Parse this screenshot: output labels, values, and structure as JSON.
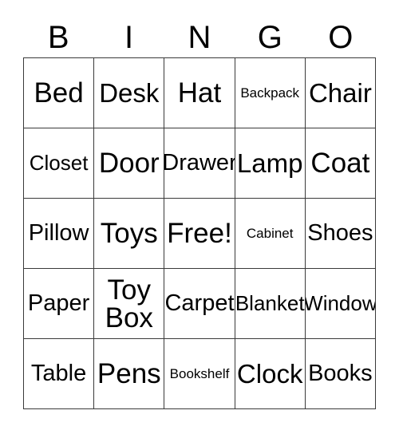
{
  "card": {
    "title": "BINGO",
    "header_letters": [
      "B",
      "I",
      "N",
      "G",
      "O"
    ],
    "free_space_label": "Free!",
    "colors": {
      "background": "#ffffff",
      "border": "#3a3a3a",
      "text": "#000000"
    },
    "grid": {
      "columns": 5,
      "rows": 5,
      "cells": [
        [
          {
            "label": "Bed",
            "size": "xl"
          },
          {
            "label": "Desk",
            "size": "lg"
          },
          {
            "label": "Hat",
            "size": "xl"
          },
          {
            "label": "Backpack",
            "size": "xs"
          },
          {
            "label": "Chair",
            "size": "lg"
          }
        ],
        [
          {
            "label": "Closet",
            "size": "sm"
          },
          {
            "label": "Door",
            "size": "xl"
          },
          {
            "label": "Drawer",
            "size": "md"
          },
          {
            "label": "Lamp",
            "size": "lg"
          },
          {
            "label": "Coat",
            "size": "xl"
          }
        ],
        [
          {
            "label": "Pillow",
            "size": "md"
          },
          {
            "label": "Toys",
            "size": "xl"
          },
          {
            "label": "Free!",
            "size": "xl"
          },
          {
            "label": "Cabinet",
            "size": "xs"
          },
          {
            "label": "Shoes",
            "size": "md"
          }
        ],
        [
          {
            "label": "Paper",
            "size": "md"
          },
          {
            "label": "Toy\nBox",
            "size": "xl"
          },
          {
            "label": "Carpet",
            "size": "md"
          },
          {
            "label": "Blanket",
            "size": "sm"
          },
          {
            "label": "Window",
            "size": "sm"
          }
        ],
        [
          {
            "label": "Table",
            "size": "md"
          },
          {
            "label": "Pens",
            "size": "xl"
          },
          {
            "label": "Bookshelf",
            "size": "xs"
          },
          {
            "label": "Clock",
            "size": "lg"
          },
          {
            "label": "Books",
            "size": "md"
          }
        ]
      ]
    }
  }
}
